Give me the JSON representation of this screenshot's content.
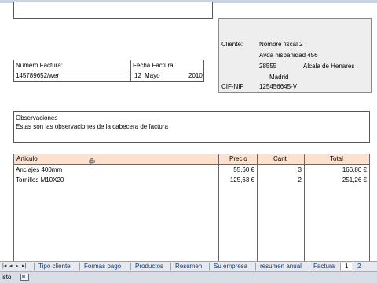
{
  "invoice": {
    "numero_label": "Numero Factura:",
    "numero_value": "145789652/wer",
    "fecha_label": "Fecha Factura",
    "fecha_day": "12",
    "fecha_month": "Mayo",
    "fecha_year": "2010"
  },
  "client": {
    "label": "Cliente:",
    "name": "Nombre fiscal 2",
    "address": "Avda hispanidad 456",
    "postal_code": "28555",
    "city": "Alcala de Henares",
    "province": "Madrid",
    "cif_label": "CIF-NIF",
    "cif_value": "125456645-V"
  },
  "observaciones": {
    "title": "Observaciones",
    "text": "Estas son las observaciones de la cabecera de factura"
  },
  "table": {
    "headers": {
      "articulo": "Articulo",
      "precio": "Precio",
      "cant": "Cant",
      "total": "Total"
    },
    "rows": [
      {
        "articulo": "Anclajes 400mm",
        "precio": "55,60 €",
        "cant": "3",
        "total": "166,80 €"
      },
      {
        "articulo": "Tornillos M10X20",
        "precio": "125,63 €",
        "cant": "2",
        "total": "251,26 €"
      }
    ]
  },
  "sheets": {
    "tabs": [
      "Tipo cliente",
      "Formas pago",
      "Productos",
      "Resumen",
      "Su empresa",
      "resumen anual",
      "Factura",
      "1",
      "2"
    ],
    "active": "1"
  },
  "status": {
    "text": "isto"
  },
  "colors": {
    "header_fill": "#fde1ce",
    "client_fill": "#eeeeee"
  }
}
